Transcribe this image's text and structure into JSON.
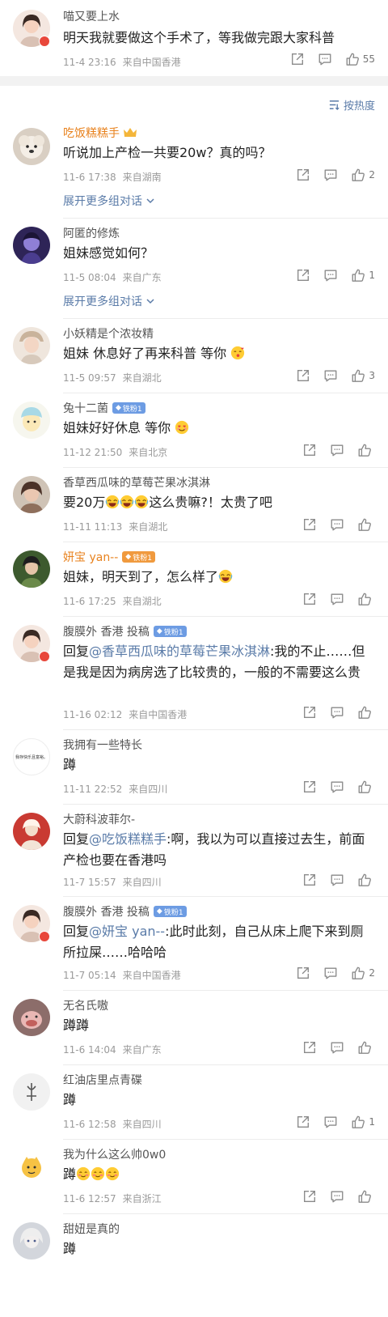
{
  "top_comment": {
    "name": "喵又要上水",
    "text": "明天我就要做这个手术了，等我做完跟大家科普",
    "time": "11-4 23:16",
    "location": "来自中国香港",
    "likes": "55"
  },
  "sort": {
    "label": "按热度"
  },
  "expand_label": "展开更多组对话",
  "comments": [
    {
      "name": "吃饭糕糕手",
      "text": "听说加上产检一共要20w？真的吗？",
      "time": "11-6 17:38",
      "location": "来自湖南",
      "likes": "2"
    },
    {
      "name": "阿匿的修炼",
      "text": "姐妹感觉如何？",
      "time": "11-5 08:04",
      "location": "来自广东",
      "likes": "1"
    },
    {
      "name": "小妖精是个浓妆精",
      "text": "姐妹 休息好了再来科普 等你",
      "time": "11-5 09:57",
      "location": "来自湖北",
      "likes": "3"
    },
    {
      "name": "兔十二菌",
      "badge": "铁粉1",
      "text": "姐妹好好休息 等你",
      "time": "11-12 21:50",
      "location": "来自北京",
      "likes": ""
    },
    {
      "name": "香草西瓜味的草莓芒果冰淇淋",
      "text_a": "要20万",
      "text_b": "这么贵嘛?！太贵了吧",
      "time": "11-11 11:13",
      "location": "来自湖北",
      "likes": ""
    },
    {
      "name": "妍宝 yan--",
      "badge": "铁粉1",
      "text": "姐妹，明天到了，怎么样了",
      "time": "11-6 17:25",
      "location": "来自湖北",
      "likes": ""
    },
    {
      "name": "腹膜外 香港 投稿",
      "badge": "铁粉1",
      "reply_prefix": "回复",
      "mention": "@香草西瓜味的草莓芒果冰淇淋",
      "text": ":我的不止……但是我是因为病房选了比较贵的，一般的不需要这么贵",
      "time": "11-16 02:12",
      "location": "来自中国香港",
      "likes": ""
    },
    {
      "name": "我拥有一些特长",
      "avatar_text": "我存快乐且富裕。",
      "text": "蹲",
      "time": "11-11 22:52",
      "location": "来自四川",
      "likes": ""
    },
    {
      "name": "大蔚科波菲尔-",
      "reply_prefix": "回复",
      "mention": "@吃饭糕糕手",
      "text": ":啊，我以为可以直接过去生，前面产检也要在香港吗",
      "time": "11-7 15:57",
      "location": "来自四川",
      "likes": ""
    },
    {
      "name": "腹膜外 香港 投稿",
      "badge": "铁粉1",
      "reply_prefix": "回复",
      "mention": "@妍宝 yan--",
      "text": ":此时此刻，自己从床上爬下来到厕所拉屎……哈哈哈",
      "time": "11-7 05:14",
      "location": "来自中国香港",
      "likes": "2"
    },
    {
      "name": "无名氏嗷",
      "text": "蹲蹲",
      "time": "11-6 14:04",
      "location": "来自广东",
      "likes": ""
    },
    {
      "name": "红油店里点青碟",
      "text": "蹲",
      "time": "11-6 12:58",
      "location": "来自四川",
      "likes": "1"
    },
    {
      "name": "我为什么这么帅0w0",
      "text": "蹲",
      "time": "11-6 12:57",
      "location": "来自浙江",
      "likes": ""
    },
    {
      "name": "甜妞是真的",
      "text": "蹲",
      "time": "",
      "location": "",
      "likes": ""
    }
  ],
  "colors": {
    "link": "#5a7ba8",
    "orange_name": "#e8821e",
    "fan_badge": "#6d9ce3",
    "divider": "#ececec"
  }
}
